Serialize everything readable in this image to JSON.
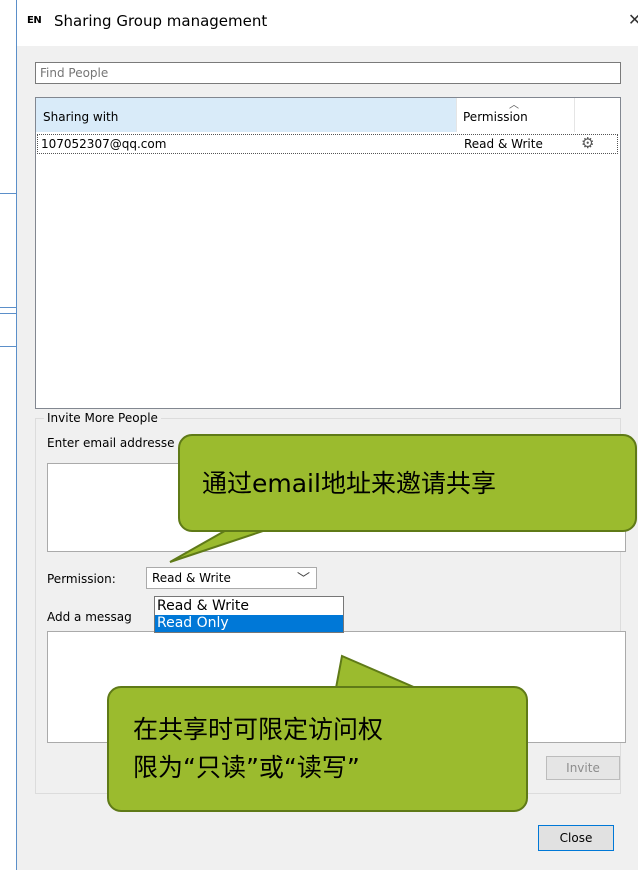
{
  "window": {
    "logo_text": "EN",
    "title": "Sharing Group management",
    "close_glyph": "X"
  },
  "search": {
    "placeholder": "Find People"
  },
  "list": {
    "col_sharing": "Sharing with",
    "col_permission": "Permission",
    "sort_caret": "^",
    "rows": [
      {
        "email": "107052307@qq.com",
        "permission": "Read & Write",
        "action_icon": "gear-icon"
      }
    ]
  },
  "invite": {
    "legend": "Invite More People",
    "email_label": "Enter email addresse",
    "permission_label": "Permission:",
    "permission_value": "Read & Write",
    "permission_options": [
      "Read & Write",
      "Read Only"
    ],
    "selected_option": "Read Only",
    "message_label": "Add a messag",
    "invite_button": "Invite"
  },
  "close_button": "Close",
  "callouts": {
    "email_invite": "通过email地址来邀请共享",
    "permission_line1": "在共享时可限定访问权",
    "permission_line2": "限为“只读”或“读写”"
  },
  "colors": {
    "header_selected": "#d9ebf9",
    "dropdown_highlight": "#0078d7",
    "callout_fill": "#9bbb2e",
    "callout_border": "#5f7a17"
  }
}
